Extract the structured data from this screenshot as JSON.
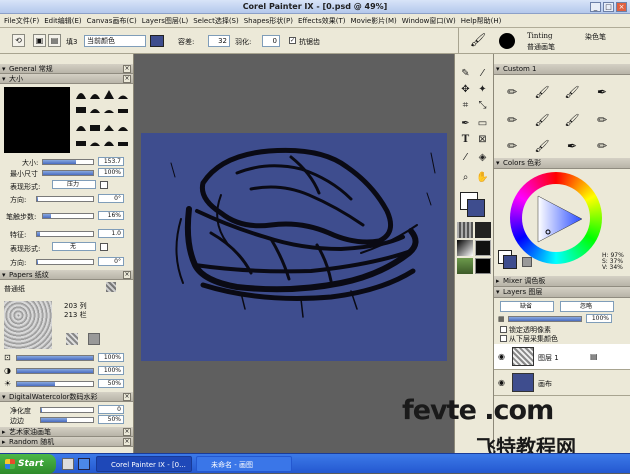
{
  "window": {
    "title": "Corel Painter IX - [0.psd @ 49%]"
  },
  "menu": [
    "File文件(F)",
    "Edit编辑(E)",
    "Canvas画布(C)",
    "Layers图层(L)",
    "Select选择(S)",
    "Shapes形状(P)",
    "Effects效果(T)",
    "Movie影片(M)",
    "Window窗口(W)",
    "Help帮助(H)"
  ],
  "propbar": {
    "fill_label": "填3",
    "fill_value": "当前颜色",
    "tolerance_label": "容差:",
    "tolerance_value": "32",
    "feather_label": "羽化:",
    "feather_value": "0",
    "antialias_label": "抗锯齿"
  },
  "brush_selector": {
    "category": "Tinting",
    "category_cn": "染色笔",
    "variant": "普通画笔"
  },
  "left_panel": {
    "general_header": "General 常规",
    "size_header": "大小",
    "size_label": "大小:",
    "size_value": "153.7",
    "min_size_label": "最小尺寸",
    "min_size_value": "100%",
    "expression_label": "表现形式:",
    "expression_value": "压力",
    "direction_label": "方向:",
    "direction_value": "0°",
    "step_label": "笔触步数:",
    "step_value": "16%",
    "feature_label": "特征:",
    "feature_value": "1.0",
    "expression2_label": "表现形式:",
    "expression2_value": "无",
    "direction2_label": "方向:",
    "direction2_value": "0°",
    "papers_header": "Papers 纸纹",
    "paper_name": "普通纸",
    "paper_cols": "203 列",
    "paper_rows": "213 栏",
    "paper_scale_value": "100%",
    "paper_contrast_value": "100%",
    "paper_brightness_value": "50%",
    "watercolor_header": "DigitalWatercolor数码水彩",
    "wet_label": "净化度",
    "wet_value": "0",
    "edge_label": "边边",
    "edge_value": "50%",
    "artoil_header": "艺术家油画笔",
    "random_header": "Random 随机"
  },
  "right_panel": {
    "custom_header": "Custom 1",
    "colors_header": "Colors 色彩",
    "hsv": {
      "h": "H: 97%",
      "s": "S: 37%",
      "v": "V: 34%"
    },
    "mixer_header": "Mixer 调色板",
    "layers_header": "Layers 图层",
    "composite_method": "缺省",
    "composite_depth": "忽略",
    "opacity_value": "100%",
    "lock_transparency": "锁定透明像素",
    "pick_up_color": "从下层采集颜色",
    "layers": [
      {
        "name": "图层 1"
      },
      {
        "name": "画布"
      }
    ]
  },
  "colors": {
    "main": "#3e4d8e",
    "secondary": "#ffffff",
    "accent": "#4a6cc0"
  },
  "taskbar": {
    "start": "Start",
    "tasks": [
      "Corel Painter IX - [0...",
      "未命名 - 画图"
    ]
  },
  "watermark": {
    "line1": "fevte .com",
    "line2": "飞特教程网"
  }
}
